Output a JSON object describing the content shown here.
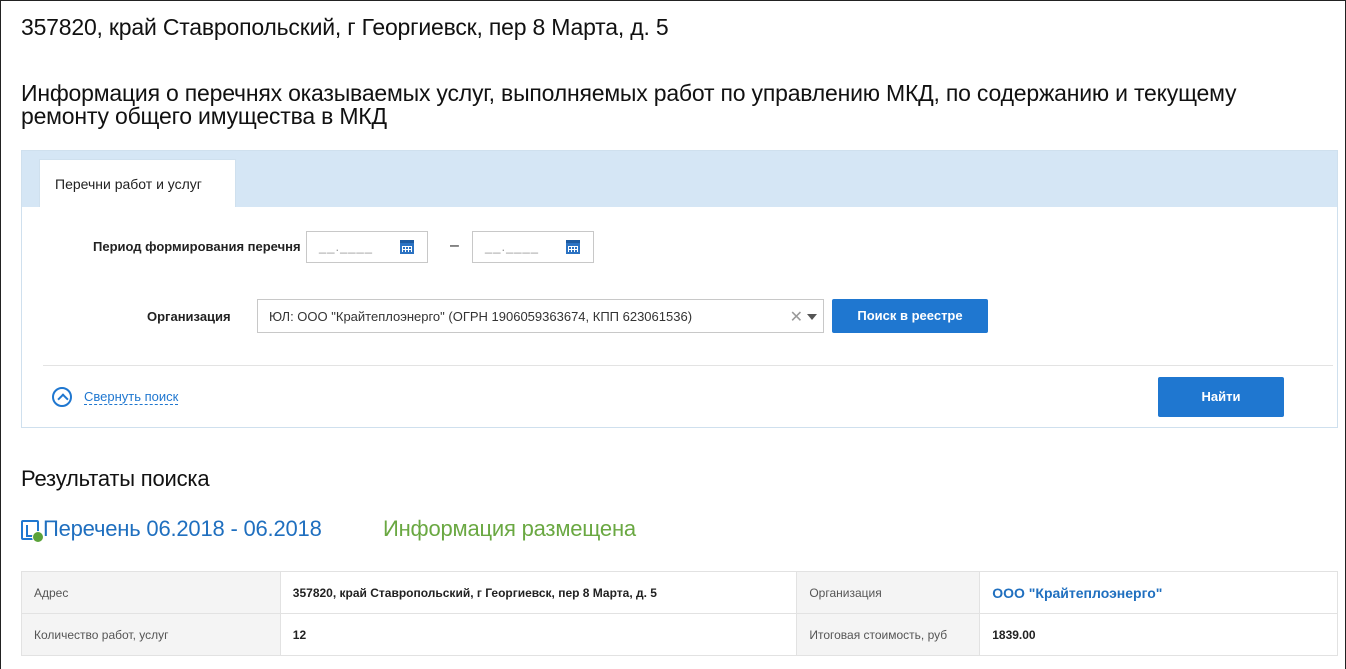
{
  "address_title": "357820, край Ставропольский, г Георгиевск, пер 8 Марта, д. 5",
  "section_title": "Информация о перечнях оказываемых услуг, выполняемых работ по управлению МКД, по содержанию и текущему ремонту общего имущества в МКД",
  "search": {
    "tab_label": "Перечни работ и услуг",
    "period_label": "Период формирования перечня",
    "date_from_placeholder": "__.____",
    "date_to_placeholder": "__.____",
    "dash": "–",
    "org_label": "Организация",
    "org_value": "ЮЛ: ООО \"Крайтеплоэнерго\" (ОГРН 1906059363674, КПП 623061536)",
    "registry_button": "Поиск в реестре",
    "collapse_label": "Свернуть поиск",
    "find_button": "Найти"
  },
  "results": {
    "title": "Результаты поиска",
    "list_title": "Перечень 06.2018 - 06.2018",
    "status": "Информация размещена",
    "rows": [
      {
        "k1": "Адрес",
        "v1": "357820, край Ставропольский, г Георгиевск, пер 8 Марта, д. 5",
        "k2": "Организация",
        "v2": "ООО \"Крайтеплоэнерго\""
      },
      {
        "k1": "Количество работ, услуг",
        "v1": "12",
        "k2": "Итоговая стоимость, руб",
        "v2": "1839.00"
      }
    ]
  }
}
